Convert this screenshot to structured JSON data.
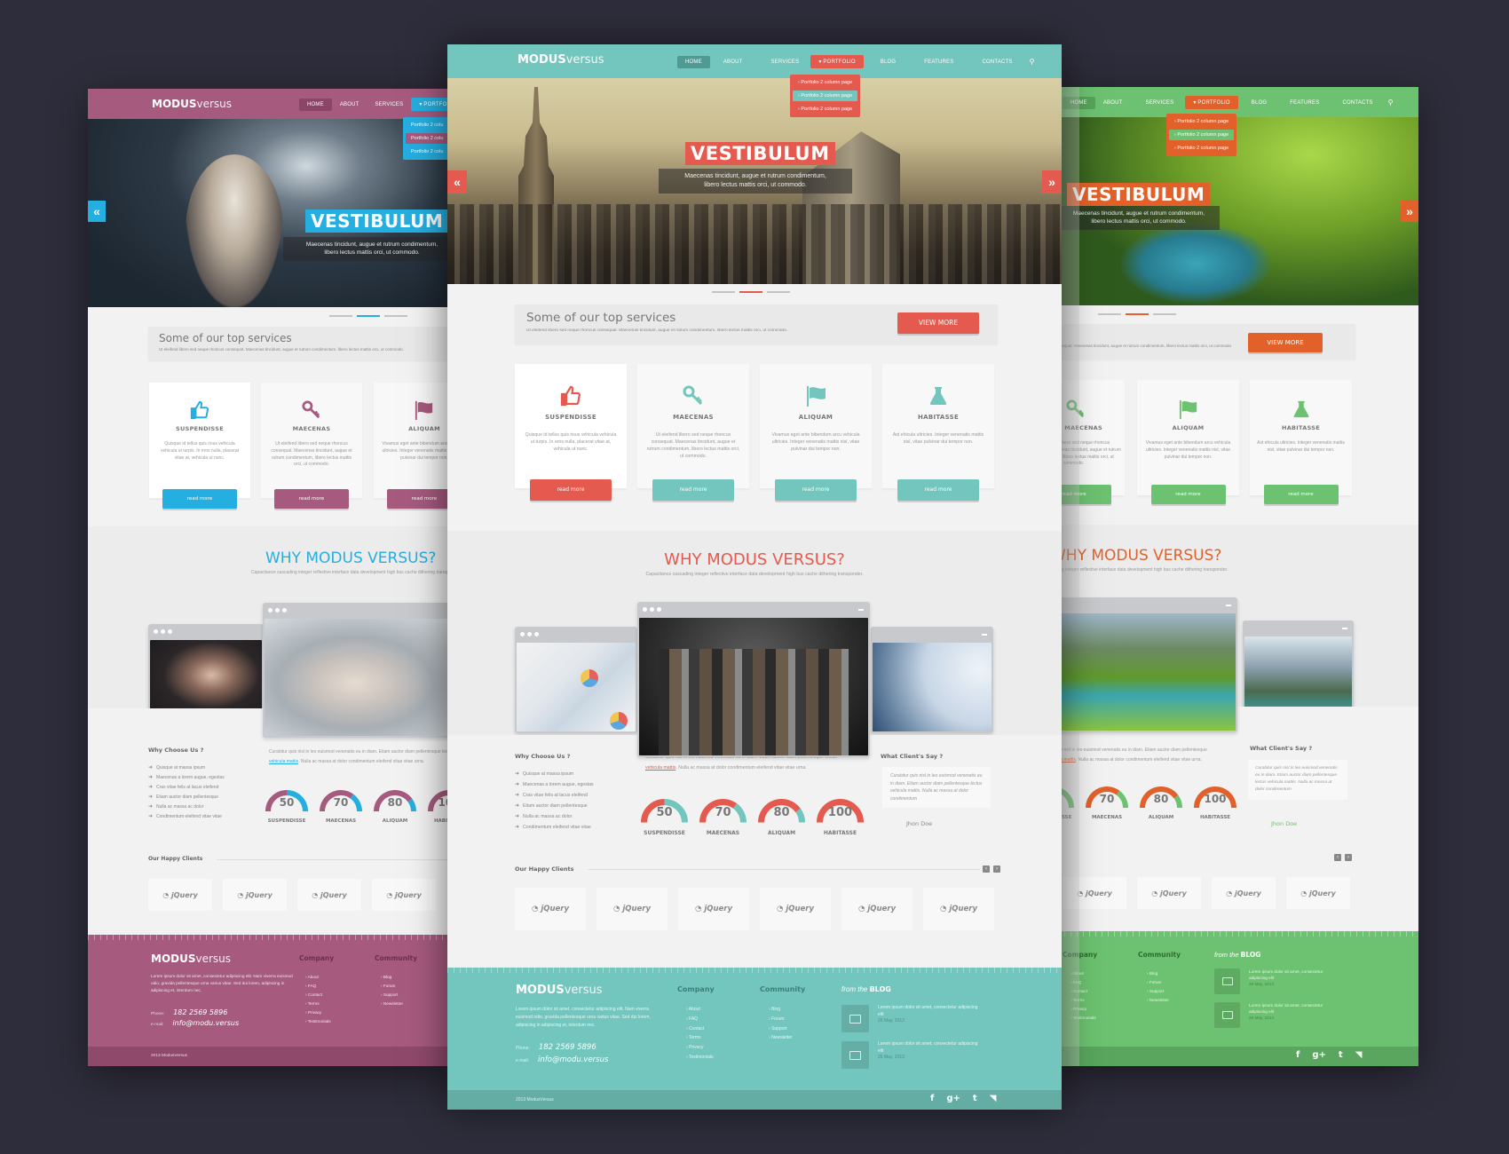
{
  "brand": {
    "bold": "MODUS",
    "light": "versus"
  },
  "nav": [
    "HOME",
    "ABOUT",
    "SERVICES",
    "PORTFOLIO",
    "BLOG",
    "FEATURES",
    "CONTACTS"
  ],
  "nav_active": "HOME",
  "dropdown": [
    "Portfolio 2 column page",
    "Portfolio 2 column page",
    "Portfolio 2 column page"
  ],
  "dropdown_short": [
    "Portfolio 2 colu",
    "Portfolio 2 colu",
    "Portfolio 2 colu"
  ],
  "hero": {
    "title": "VESTIBULUM",
    "caption_1": "Maecenas tincidunt, augue et rutrum condimentum,",
    "caption_2": "libero lectus mattis orci, ut commodo."
  },
  "services": {
    "title": "Some of our top services",
    "desc": "Ut eleifend libero sed neque rhoncus consequat. Maecenas tincidunt, augue et rutrum condimentum, libero lectus mattis orci, ut commodo.",
    "view_more": "VIEW MORE",
    "read_more": "read more",
    "cards": [
      {
        "icon": "thumbs-up",
        "title": "SUSPENDISSE",
        "text": "Quisque id tellus quis risus vehicula vehicula ut turpis. In eros nulla, placerat vitae at, vehicula ut nunc."
      },
      {
        "icon": "key",
        "title": "MAECENAS",
        "text": "Ut eleifend libero sed neque rhoncus consequat. Maecenas tincidunt, augue et rutrum condimentum, libero lectus mattis orci, ut commodo."
      },
      {
        "icon": "flag",
        "title": "ALIQUAM",
        "text": "Vivamus eget ante bibendum arcu vehicula ultricies. Integer venenatis mattis nisl, vitae pulvinar dui tempor non."
      },
      {
        "icon": "flask",
        "title": "HABITASSE",
        "text": "Ast ehicula ultricies. Integer venenatis mattis nisl, vitae pulvinar dui tempor non."
      }
    ]
  },
  "why": {
    "title": "WHY MODUS VERSUS?",
    "sub": "Capacitance cascading integer reflective interface data development high bus cache dithering transponder."
  },
  "choose": {
    "title": "Why Choose Us ?",
    "items": [
      "Quisque at massa ipsum",
      "Maecenas a lorem augue, egestas",
      "Cras vitae felis at lacus eleifend",
      "Etiam auctor diam pellentesque",
      "Nulla ac massa ac dolor",
      "Condimentum eleifend vitae vitae"
    ]
  },
  "intro": {
    "pre": "Curabitur quis nisl in leo euismod venenatis eu in diam. Etiam auctor diam pellentesque lectus ",
    "link": "vehicula mattis",
    "post": ". Nulla ac massa at dolor condimentum eleifend vitae vitae urna."
  },
  "gauges": [
    {
      "label": "SUSPENDISSE",
      "value": 50
    },
    {
      "label": "MAECENAS",
      "value": 70
    },
    {
      "label": "ALIQUAM",
      "value": 80
    },
    {
      "label": "HABITASSE",
      "value": 100
    }
  ],
  "testimonial": {
    "title": "What Client's Say ?",
    "quote": "Curabitur quis nisl in leo euismod venenatis eu in diam. Etiam auctor diam pellentesque lectus vehicula mattis. Nulla ac massa at dolor condimentum",
    "author": "Jhon Doe"
  },
  "clients": {
    "title": "Our Happy Clients",
    "logos": [
      "jQuery",
      "jQuery",
      "jQuery",
      "jQuery",
      "jQuery",
      "jQuery"
    ],
    "prev": "‹",
    "next": "›"
  },
  "footer": {
    "desc": "Lorem ipsum dolor sit amet, consectetur adipiscing elit. Nam viverra euismod odio, gravida pellentesque urna varius vitae. Sed dui lorem, adipiscing in adipiscing et, interdum nec.",
    "phone_label": "Phone:",
    "phone": "182 2569 5896",
    "email_label": "e-mail:",
    "email": "info@modu.versus",
    "company_title": "Company",
    "company": [
      "About",
      "FAQ",
      "Contact",
      "Terms",
      "Privacy",
      "Testimonials"
    ],
    "community_title": "Community",
    "community": [
      "Blog",
      "Forum",
      "Support",
      "Newsletter"
    ],
    "blog_pre": "from the",
    "blog_bold": "BLOG",
    "blog": [
      {
        "text": "Lorem ipsum dolor sit amet, consectetur adipiscing elit",
        "date": "26 May, 2013"
      },
      {
        "text": "Lorem ipsum dolor sit amet, consectetur adipiscing elit",
        "date": "26 May, 2013"
      }
    ],
    "copyright": "2013 ModusVersus",
    "social": [
      "facebook",
      "google-plus",
      "twitter",
      "rss"
    ]
  },
  "themes": {
    "teal": {
      "primary": "#72c6bd",
      "accent": "#e55a4f",
      "dark": "#5ea9a1"
    },
    "purple": {
      "primary": "#a65a7e",
      "accent": "#25aee0",
      "dark": "#8f4a6b"
    },
    "green": {
      "primary": "#6cc270",
      "accent": "#e2612a",
      "dark": "#5aa65e"
    }
  }
}
